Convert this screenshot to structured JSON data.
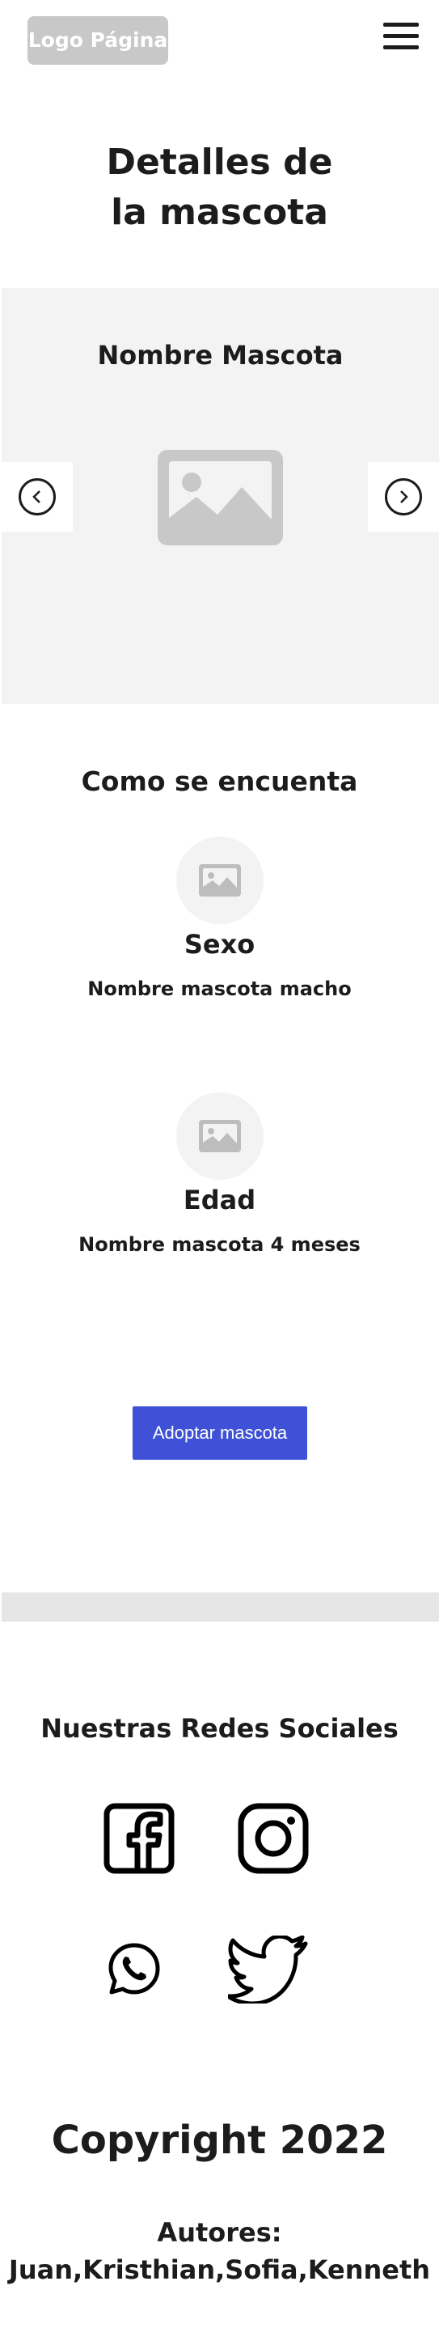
{
  "header": {
    "logo_text": "Logo Página"
  },
  "page": {
    "title_line1": "Detalles de",
    "title_line2": "la mascota"
  },
  "carousel": {
    "pet_name": "Nombre Mascota"
  },
  "status": {
    "title": "Como se encuenta",
    "items": [
      {
        "label": "Sexo",
        "value": "Nombre mascota macho"
      },
      {
        "label": "Edad",
        "value": "Nombre mascota 4 meses"
      }
    ]
  },
  "actions": {
    "adopt_label": "Adoptar mascota"
  },
  "social": {
    "title": "Nuestras Redes Sociales",
    "icons": [
      "facebook-icon",
      "instagram-icon",
      "whatsapp-icon",
      "twitter-icon"
    ]
  },
  "footer": {
    "copyright": "Copyright 2022",
    "authors_label": "Autores:",
    "authors": "Juan,Kristhian,Sofia,Kenneth"
  },
  "colors": {
    "primary_button": "#3f51d6",
    "placeholder_gray": "#c8c8c8",
    "panel_bg": "#f3f3f3",
    "divider": "#e6e6e6",
    "text": "#1c1c1c"
  }
}
